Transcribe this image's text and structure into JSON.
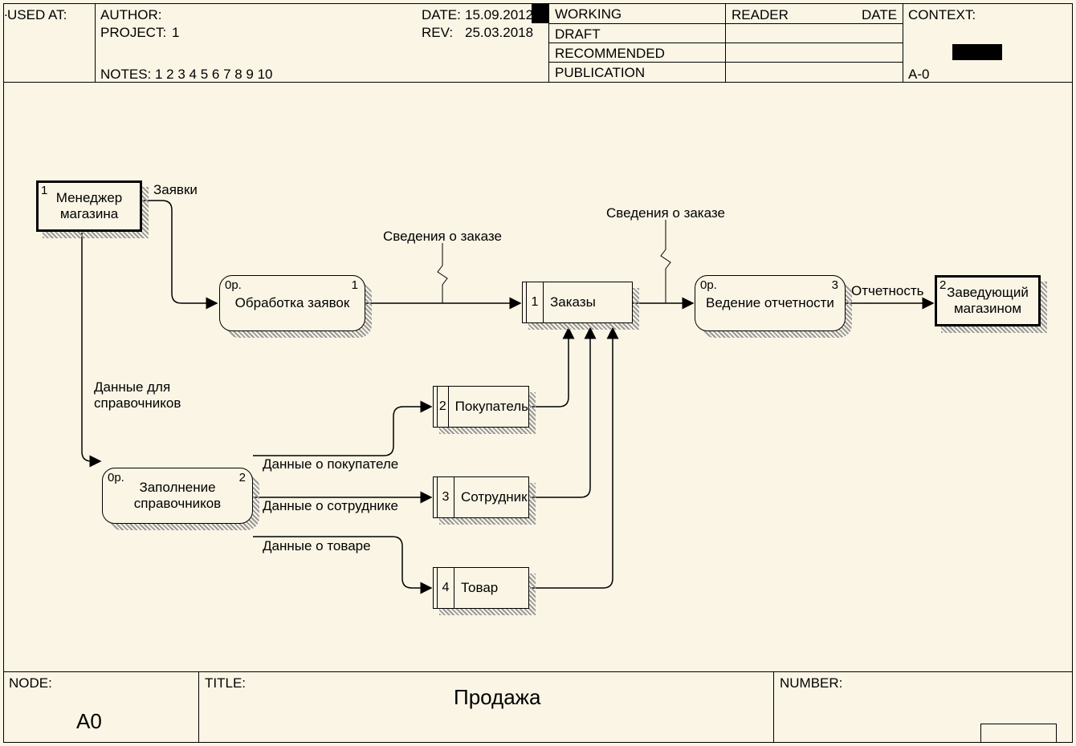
{
  "header": {
    "used_at_label": "USED AT:",
    "author_label": "AUTHOR:",
    "project_label": "PROJECT:",
    "project_value": "1",
    "notes_label": "NOTES:",
    "notes_value": "1  2  3  4  5  6  7  8  9  10",
    "date_label": "DATE:",
    "date_value": "15.09.2012",
    "rev_label": "REV:",
    "rev_value": "25.03.2018",
    "working": "WORKING",
    "draft": "DRAFT",
    "recommended": "RECOMMENDED",
    "publication": "PUBLICATION",
    "reader_label": "READER",
    "date2_label": "DATE",
    "context_label": "CONTEXT:",
    "context_code": "A-0"
  },
  "footer": {
    "node_label": "NODE:",
    "node_value": "A0",
    "title_label": "TITLE:",
    "title_value": "Продажа",
    "number_label": "NUMBER:"
  },
  "nodes": {
    "ext1_num": "1",
    "ext1": "Менеджер магазина",
    "ext2_num": "2",
    "ext2": "Заведующий магазином",
    "p1_cost": "0р.",
    "p1_num": "1",
    "p1": "Обработка заявок",
    "p2_cost": "0р.",
    "p2_num": "2",
    "p2": "Заполнение справочников",
    "p3_cost": "0р.",
    "p3_num": "3",
    "p3": "Ведение отчетности",
    "ds1_num": "1",
    "ds1": "Заказы",
    "ds2_num": "2",
    "ds2": "Покупатель",
    "ds3_num": "3",
    "ds3": "Сотрудник",
    "ds4_num": "4",
    "ds4": "Товар"
  },
  "arrows": {
    "a1": "Заявки",
    "a2": "Данные для справочников",
    "a3": "Данные о покупателе",
    "a4": "Данные о сотруднике",
    "a5": "Данные о товаре",
    "a6": "Сведения о заказе",
    "a7": "Сведения о заказе",
    "a8": "Отчетность"
  }
}
